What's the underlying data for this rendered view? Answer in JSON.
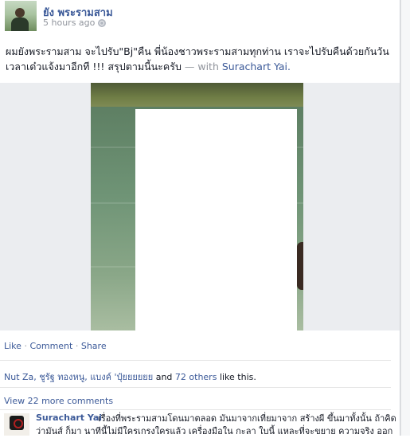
{
  "post": {
    "author": "ยัง พระรามสาม",
    "timestamp": "5 hours ago",
    "text": "ผมยังพระรามสาม จะไปรับ\"Bj\"คืน พี่น้องชาวพระรามสามทุกท่าน เราจะไปรับคืนด้วยกันวัน เวลาเด๋วแจ้งมาอีกที !!! สรุปตามนี้นะครับ",
    "with_separator": "— with",
    "tagged_user": "Surachart Yai."
  },
  "actions": {
    "like": "Like",
    "comment": "Comment",
    "share": "Share",
    "separator": "·"
  },
  "likes": {
    "names": "Nut Za, ชูรัฐ ทองหนู, แบงค์ 'ปุ๋ยยยยยย",
    "and_text": "and",
    "others": "72 others",
    "suffix": "like this."
  },
  "comments": {
    "view_more": "View 22 more comments",
    "items": [
      {
        "author": "Surachart Yai",
        "text": "เรื่องที่พระรามสามโดนมาตลอด มันมาจากเที่ยมาจาก สร้างผี ขึ้นมาทั้งนั้น ถ้าคิดว่ามันส์ ก็มา นาทีนี้ไม่มีใครเกรงใครแล้ว เครื่องมือใน กะลา ใบนี้ แหละที่จะขยาย ความจริง ออก"
      }
    ]
  },
  "colors": {
    "link": "#3b5998",
    "muted": "#90949c",
    "text": "#141823"
  }
}
